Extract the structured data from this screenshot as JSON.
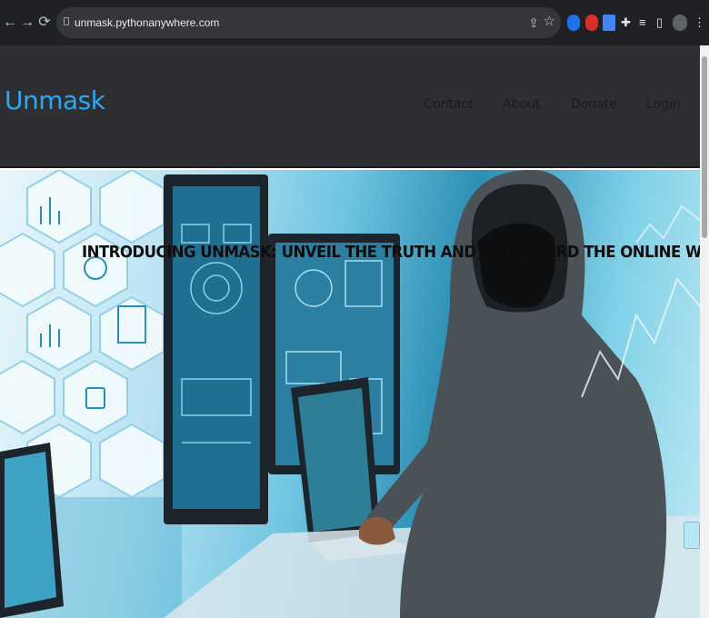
{
  "browser": {
    "url": "unmask.pythonanywhere.com",
    "back_icon": "arrow-left",
    "forward_icon": "arrow-right",
    "reload_icon": "reload",
    "share_icon": "share",
    "bookmark_icon": "star",
    "extensions": [
      "blue-circle-extension",
      "red-shield-extension",
      "blue-square-extension",
      "puzzle-extension",
      "reading-list",
      "side-panel",
      "profile-avatar",
      "menu"
    ]
  },
  "site": {
    "logo": "Unmask",
    "nav": [
      {
        "label": "Contact"
      },
      {
        "label": "About"
      },
      {
        "label": "Donate"
      },
      {
        "label": "Login"
      }
    ]
  },
  "hero": {
    "title": "INTRODUCING UNMASK: UNVEIL THE TRUTH AND SAFEGUARD THE ONLINE WORLD"
  },
  "colors": {
    "chrome_bg": "#202124",
    "header_bg": "#2d2f33",
    "logo": "#2aa8f2",
    "nav_text": "#1a1b1e",
    "hero_title": "#0d0d0d"
  }
}
